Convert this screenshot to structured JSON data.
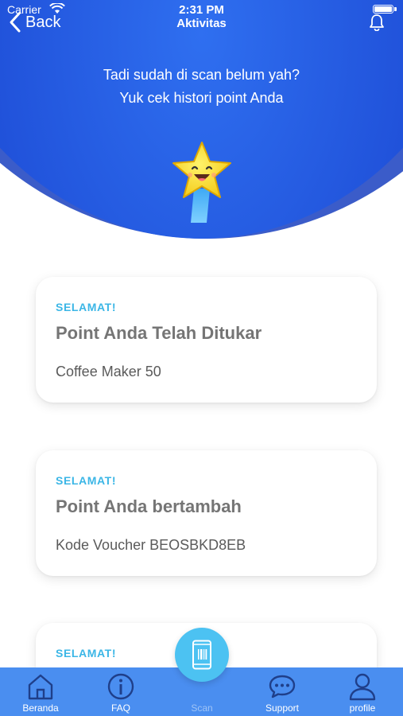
{
  "status_bar": {
    "carrier": "Carrier",
    "time": "2:31 PM"
  },
  "nav": {
    "back_label": "Back",
    "title": "Aktivitas",
    "bell_icon": "bell-icon"
  },
  "header": {
    "line1": "Tadi sudah di scan belum yah?",
    "line2": "Yuk cek histori point Anda"
  },
  "cards": [
    {
      "tag": "SELAMAT!",
      "title": "Point Anda Telah Ditukar",
      "desc": "Coffee Maker 50"
    },
    {
      "tag": "SELAMAT!",
      "title": "Point Anda bertambah",
      "desc": "Kode Voucher BEOSBKD8EB"
    },
    {
      "tag": "SELAMAT!",
      "title": "",
      "desc": ""
    }
  ],
  "tabbar": {
    "items": [
      {
        "label": "Beranda",
        "icon": "home-icon"
      },
      {
        "label": "FAQ",
        "icon": "info-icon"
      },
      {
        "label": "Scan",
        "icon": "phone-scan-icon"
      },
      {
        "label": "Support",
        "icon": "chat-icon"
      },
      {
        "label": "profile",
        "icon": "user-icon"
      }
    ]
  },
  "colors": {
    "header_blue": "#1f4fd8",
    "tabbar_blue": "#4a8ef0",
    "accent_cyan": "#3bb6e6",
    "scan_button": "#4cc2f2"
  }
}
